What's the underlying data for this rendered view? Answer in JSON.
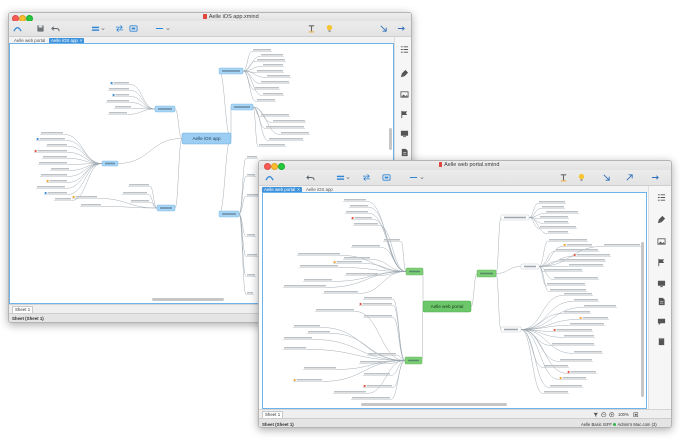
{
  "back": {
    "title": "Aelle iOS app.xmind",
    "tabs": [
      {
        "label": "Aelle web portal",
        "active": false
      },
      {
        "label": "Aelle iOS app",
        "active": true
      }
    ],
    "central_topic": "Aelle iOS app",
    "sheet_tab": "Sheet 1",
    "status": "Sheet (Sheet 1)"
  },
  "front": {
    "title": "Aelle web portal.xmind",
    "tabs": [
      {
        "label": "Aelle web portal",
        "active": true
      },
      {
        "label": "Aelle iOS app",
        "active": false
      }
    ],
    "central_topic": "Aelle web portal",
    "sheet_tab": "Sheet 1",
    "status": "Sheet (Sheet 1)",
    "status_right": {
      "workbook": "Aelle Basic ISFF",
      "user": "Admin's Mac.com (3)"
    },
    "zoom": "100%"
  },
  "close_glyph": "×",
  "colors": {
    "accent": "#3e93dc",
    "canvas_border": "#6db3ea",
    "topic_blue": "#a9d5f5",
    "topic_blue_border": "#6aaee3",
    "central_blue": "#9ccdf2",
    "topic_green": "#7fcf78",
    "topic_green_border": "#4fae4a",
    "central_green": "#6cc66a",
    "branch": "#9aa5ae",
    "leaf_text": "#bcc1c6",
    "marker_red": "#e5533d",
    "marker_orange": "#f3a52a",
    "marker_blue": "#3a8fd8"
  },
  "icons": {
    "toolbar": [
      "structure-icon",
      "save-icon",
      "undo-icon",
      "topic-icon",
      "subtopic-icon",
      "boundary-icon",
      "summary-icon",
      "label-icon",
      "idea-icon",
      "arrow-down-right-icon",
      "arrow-up-right-icon",
      "arrow-right-icon"
    ],
    "side_panel": [
      "outline-icon",
      "format-icon",
      "image-icon",
      "marker-icon",
      "icon-gallery-icon",
      "notes-icon",
      "comments-icon",
      "task-icon"
    ],
    "status": [
      "filter-icon",
      "zoom-out-icon",
      "zoom-in-icon",
      "fit-icon"
    ]
  }
}
